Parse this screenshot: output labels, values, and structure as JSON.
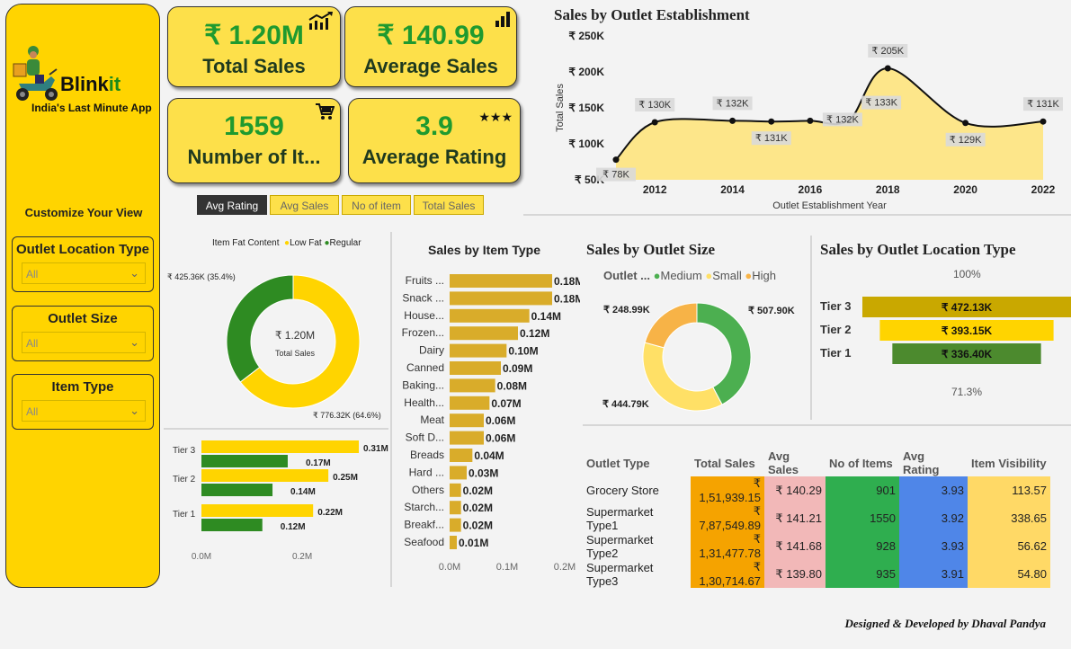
{
  "sidebar": {
    "brand_main": "Blink",
    "brand_accent": "it",
    "tagline": "India's Last Minute App",
    "customize_label": "Customize Your View",
    "filters": [
      {
        "label": "Outlet Location Type",
        "value": "All"
      },
      {
        "label": "Outlet Size",
        "value": "All"
      },
      {
        "label": "Item Type",
        "value": "All"
      }
    ]
  },
  "kpis": [
    {
      "value": "₹ 1.20M",
      "label": "Total Sales",
      "icon": "trend-up-icon"
    },
    {
      "value": "₹ 140.99",
      "label": "Average Sales",
      "icon": "bar-chart-icon"
    },
    {
      "value": "1559",
      "label": "Number of It...",
      "icon": "cart-icon"
    },
    {
      "value": "3.9",
      "label": "Average Rating",
      "icon": "stars-icon"
    }
  ],
  "tabs": [
    "Avg Rating",
    "Avg Sales",
    "No of item",
    "Total Sales"
  ],
  "active_tab": "Avg Rating",
  "colors": {
    "yellow": "#ffd400",
    "green": "#2e8b22",
    "kpi_green": "#1f9a2f",
    "area": "#fde68a"
  },
  "establishment_chart": {
    "title": "Sales by Outlet Establishment",
    "xlabel": "Outlet Establishment Year",
    "ylabel": "Total Sales",
    "y_ticks": [
      "₹ 250K",
      "₹ 200K",
      "₹ 150K",
      "₹ 100K",
      "₹ 50K"
    ],
    "x_ticks": [
      "2012",
      "2014",
      "2016",
      "2018",
      "2020",
      "2022"
    ],
    "labels": [
      "₹ 78K",
      "₹ 130K",
      "₹ 132K",
      "₹ 131K",
      "₹ 132K",
      "₹ 133K",
      "₹ 205K",
      "₹ 129K",
      "₹ 131K"
    ]
  },
  "fat_chart": {
    "legend_title": "Item Fat Content",
    "legend": [
      "Low Fat",
      "Regular"
    ],
    "center_value": "₹ 1.20M",
    "center_label": "Total Sales",
    "label_regular": "₹ 425.36K (35.4%)",
    "label_lowfat": "₹ 776.32K (64.6%)"
  },
  "tier_fat_chart": {
    "x_ticks": [
      "0.0M",
      "0.2M"
    ]
  },
  "item_type_chart": {
    "title": "Sales by Item Type",
    "x_ticks": [
      "0.0M",
      "0.1M",
      "0.2M"
    ]
  },
  "size_chart": {
    "title": "Sales by Outlet Size",
    "legend_title": "Outlet ...",
    "legend": [
      "Medium",
      "Small",
      "High"
    ],
    "labels": [
      "₹ 507.90K",
      "₹ 444.79K",
      "₹ 248.99K"
    ]
  },
  "location_chart": {
    "title": "Sales by Outlet Location Type",
    "top_pct": "100%",
    "bottom_pct": "71.3%"
  },
  "table": {
    "headers": [
      "Outlet Type",
      "Total Sales",
      "Avg Sales",
      "No of Items",
      "Avg Rating",
      "Item Visibility"
    ],
    "rows": [
      [
        "Grocery Store",
        "₹ 1,51,939.15",
        "₹ 140.29",
        "901",
        "3.93",
        "113.57"
      ],
      [
        "Supermarket Type1",
        "₹ 7,87,549.89",
        "₹ 141.21",
        "1550",
        "3.92",
        "338.65"
      ],
      [
        "Supermarket Type2",
        "₹ 1,31,477.78",
        "₹ 141.68",
        "928",
        "3.93",
        "56.62"
      ],
      [
        "Supermarket Type3",
        "₹ 1,30,714.67",
        "₹ 139.80",
        "935",
        "3.91",
        "54.80"
      ]
    ]
  },
  "footer": "Designed & Developed by Dhaval Pandya",
  "chart_data": [
    {
      "type": "area",
      "title": "Sales by Outlet Establishment",
      "xlabel": "Outlet Establishment Year",
      "ylabel": "Total Sales",
      "x": [
        2011,
        2012,
        2014,
        2015,
        2016,
        2017,
        2018,
        2020,
        2022
      ],
      "values": [
        78,
        130,
        132,
        131,
        132,
        133,
        205,
        129,
        131
      ],
      "unit": "K",
      "ylim": [
        50,
        250
      ],
      "grid": false
    },
    {
      "type": "pie",
      "title": "",
      "legend_title": "Item Fat Content",
      "categories": [
        "Low Fat",
        "Regular"
      ],
      "values": [
        776.32,
        425.36
      ],
      "unit": "K",
      "donut": true
    },
    {
      "type": "bar",
      "orientation": "horizontal",
      "categories": [
        "Tier 3",
        "Tier 2",
        "Tier 1"
      ],
      "series": [
        {
          "name": "Low Fat",
          "values": [
            0.31,
            0.25,
            0.22
          ]
        },
        {
          "name": "Regular",
          "values": [
            0.17,
            0.14,
            0.12
          ]
        }
      ],
      "unit": "M",
      "xlim": [
        0,
        0.35
      ]
    },
    {
      "type": "bar",
      "orientation": "horizontal",
      "title": "Sales by Item Type",
      "categories": [
        "Fruits ...",
        "Snack ...",
        "House...",
        "Frozen...",
        "Dairy",
        "Canned",
        "Baking...",
        "Health...",
        "Meat",
        "Soft D...",
        "Breads",
        "Hard ...",
        "Others",
        "Starch...",
        "Breakf...",
        "Seafood"
      ],
      "values": [
        0.18,
        0.18,
        0.14,
        0.12,
        0.1,
        0.09,
        0.08,
        0.07,
        0.06,
        0.06,
        0.04,
        0.03,
        0.02,
        0.02,
        0.02,
        0.01
      ],
      "labels": [
        "0.18M",
        "0.18M",
        "0.14M",
        "0.12M",
        "0.10M",
        "0.09M",
        "0.08M",
        "0.07M",
        "0.06M",
        "0.06M",
        "0.04M",
        "0.03M",
        "0.02M",
        "0.02M",
        "0.02M",
        "0.01M"
      ],
      "unit": "M",
      "xlim": [
        0,
        0.2
      ]
    },
    {
      "type": "pie",
      "title": "Sales by Outlet Size",
      "categories": [
        "Medium",
        "Small",
        "High"
      ],
      "values": [
        507.9,
        444.79,
        248.99
      ],
      "colors": [
        "#4caf50",
        "#ffe066",
        "#f7b347"
      ],
      "unit": "K",
      "donut": true
    },
    {
      "type": "bar",
      "orientation": "horizontal",
      "title": "Sales by Outlet Location Type",
      "categories": [
        "Tier 3",
        "Tier 2",
        "Tier 1"
      ],
      "values": [
        472.13,
        393.15,
        336.4
      ],
      "labels": [
        "₹ 472.13K",
        "₹ 393.15K",
        "₹ 336.40K"
      ],
      "colors": [
        "#c9a800",
        "#ffd400",
        "#4c8a2e"
      ],
      "unit": "K",
      "funnel": true
    }
  ]
}
